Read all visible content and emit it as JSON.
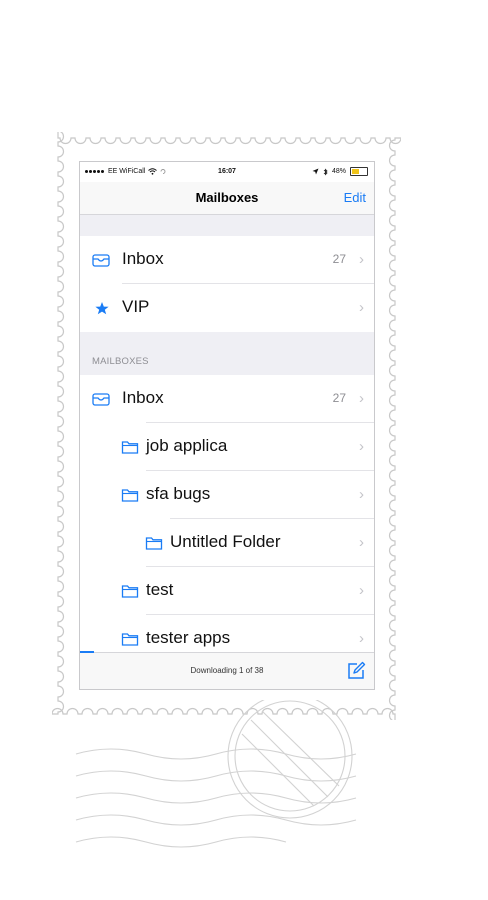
{
  "status_bar": {
    "carrier": "EE WiFiCall",
    "time": "16:07",
    "battery": "48%"
  },
  "nav": {
    "title": "Mailboxes",
    "edit": "Edit"
  },
  "top_rows": [
    {
      "label": "Inbox",
      "count": "27",
      "icon": "envelope-icon"
    },
    {
      "label": "VIP",
      "count": "",
      "icon": "star-icon"
    }
  ],
  "section_header": "MAILBOXES",
  "mailboxes": [
    {
      "label": "Inbox",
      "count": "27",
      "icon": "envelope-icon",
      "indent": 0
    },
    {
      "label": "job applica",
      "count": "",
      "icon": "folder-icon",
      "indent": 1
    },
    {
      "label": "sfa bugs",
      "count": "",
      "icon": "folder-icon",
      "indent": 1
    },
    {
      "label": "Untitled Folder",
      "count": "",
      "icon": "folder-icon",
      "indent": 2
    },
    {
      "label": "test",
      "count": "",
      "icon": "folder-icon",
      "indent": 1
    },
    {
      "label": "tester apps",
      "count": "",
      "icon": "folder-icon",
      "indent": 1
    }
  ],
  "chevron": "›",
  "toolbar": {
    "status": "Downloading 1 of 38"
  },
  "colors": {
    "accent": "#1a7cf5",
    "group_background": "#efeff4",
    "secondary_text": "#8e8e93"
  }
}
